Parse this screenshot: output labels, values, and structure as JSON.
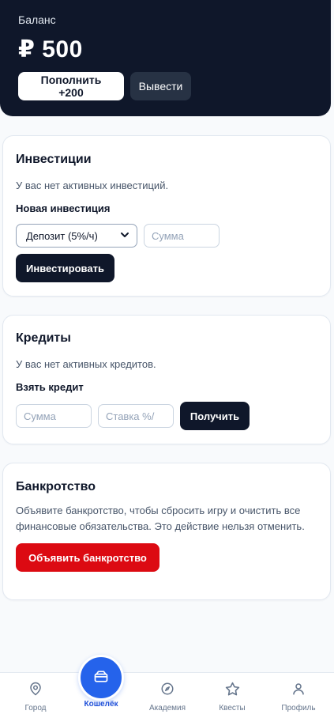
{
  "balance": {
    "label": "Баланс",
    "amount": "₽ 500",
    "topup_label": "Пополнить +200",
    "withdraw_label": "Вывести"
  },
  "investments": {
    "title": "Инвестиции",
    "empty_text": "У вас нет активных инвестиций.",
    "new_heading": "Новая инвестиция",
    "type_selected": "Депозит (5%/ч)",
    "amount_placeholder": "Сумма",
    "invest_label": "Инвестировать"
  },
  "credits": {
    "title": "Кредиты",
    "empty_text": "У вас нет активных кредитов.",
    "take_heading": "Взять кредит",
    "amount_placeholder": "Сумма",
    "rate_placeholder": "Ставка %/",
    "get_label": "Получить"
  },
  "bankruptcy": {
    "title": "Банкротство",
    "description": "Объявите банкротство, чтобы сбросить игру и очистить все финансовые обязательства. Это действие нельзя отменить.",
    "declare_label": "Объявить банкротство"
  },
  "nav": {
    "items": [
      {
        "label": "Город",
        "icon": "map-pin-icon"
      },
      {
        "label": "Кошелёк",
        "icon": "wallet-icon",
        "active": true
      },
      {
        "label": "Академия",
        "icon": "academy-icon"
      },
      {
        "label": "Квесты",
        "icon": "star-icon"
      },
      {
        "label": "Профиль",
        "icon": "user-icon"
      }
    ]
  },
  "colors": {
    "header_bg": "#0f172a",
    "accent_blue": "#2563eb",
    "danger_red": "#dc0a12"
  }
}
